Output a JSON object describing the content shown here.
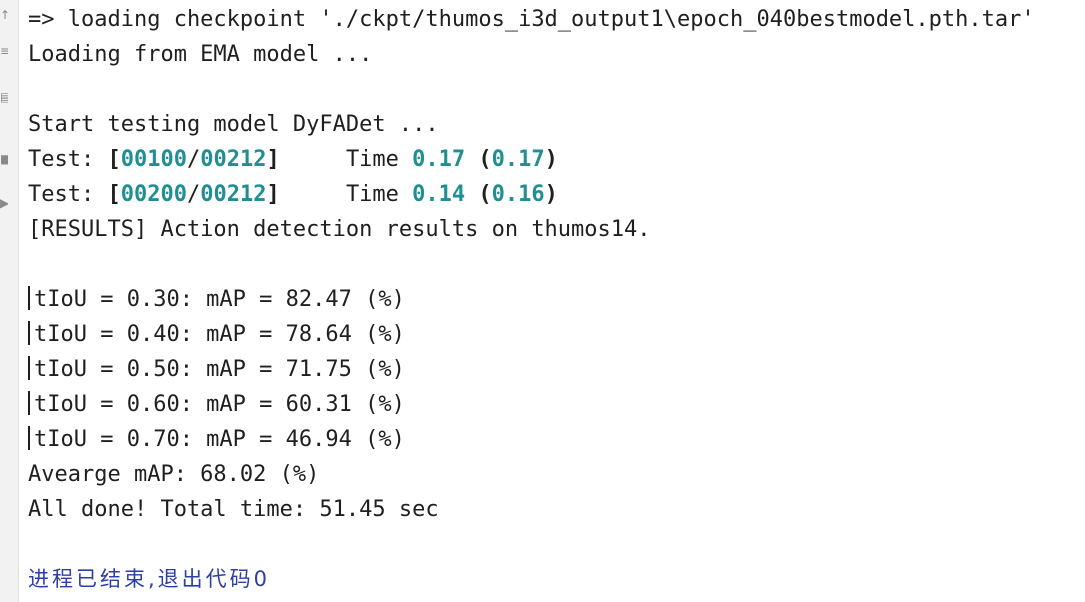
{
  "gutter": {
    "icons": [
      "fold-up-icon",
      "equals-icon",
      "print-icon",
      "trash-icon",
      "arrow-right-icon"
    ]
  },
  "console": {
    "loading_checkpoint": "=> loading checkpoint './ckpt/thumos_i3d_output1\\epoch_040bestmodel.pth.tar'",
    "loading_ema": "Loading from EMA model ...",
    "start_testing": "Start testing model DyFADet ...",
    "test_lines": [
      {
        "prefix": "Test: ",
        "current": "00100",
        "total": "00212",
        "time_label": "Time ",
        "time": "0.17",
        "avg": "0.17"
      },
      {
        "prefix": "Test: ",
        "current": "00200",
        "total": "00212",
        "time_label": "Time ",
        "time": "0.14",
        "avg": "0.16"
      }
    ],
    "results_header": "[RESULTS] Action detection results on thumos14.",
    "map_lines": [
      "tIoU = 0.30: mAP = 82.47 (%)",
      "tIoU = 0.40: mAP = 78.64 (%)",
      "tIoU = 0.50: mAP = 71.75 (%)",
      "tIoU = 0.60: mAP = 60.31 (%)",
      "tIoU = 0.70: mAP = 46.94 (%)"
    ],
    "average_map": "Avearge mAP: 68.02 (%)",
    "all_done": "All done! Total time: 51.45 sec",
    "exit_message": "进程已结束,退出代码0"
  },
  "colors": {
    "teal_number": "#1f8f94",
    "exit_text": "#2d3fa6",
    "text": "#1f1f1f"
  }
}
